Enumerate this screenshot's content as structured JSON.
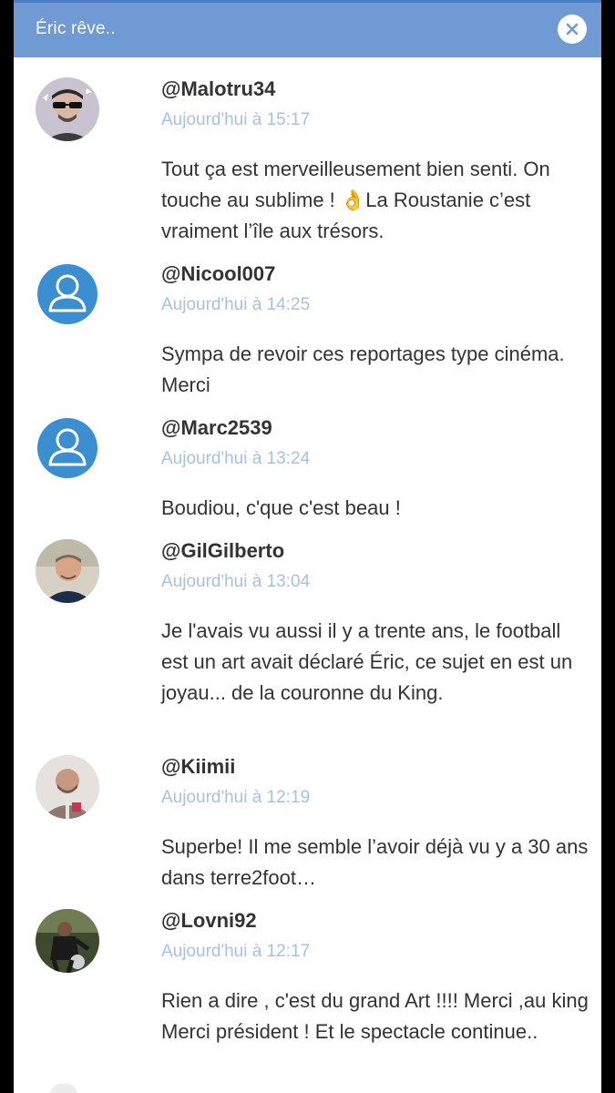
{
  "header": {
    "title": "Éric rêve..",
    "close_icon": "close-icon"
  },
  "comments": [
    {
      "username": "@Malotru34",
      "time": "Aujourd'hui à 15:17",
      "text": "Tout ça est merveilleusement bien senti. On touche au sublime ! 👌La Roustanie c’est vraiment l’île aux trésors.",
      "avatar": "photo"
    },
    {
      "username": "@Nicool007",
      "time": "Aujourd'hui à 14:25",
      "text": "Sympa de revoir ces reportages type cinéma. Merci",
      "avatar": "default-user-icon"
    },
    {
      "username": "@Marc2539",
      "time": "Aujourd'hui à 13:24",
      "text": "Boudiou, c'que c'est beau !",
      "avatar": "default-user-icon"
    },
    {
      "username": "@GilGilberto",
      "time": "Aujourd'hui à 13:04",
      "text": "Je l'avais vu aussi il y a trente ans, le football est un art avait déclaré Éric, ce sujet en est un joyau... de la couronne du King.",
      "avatar": "photo"
    },
    {
      "username": "@Kiimii",
      "time": "Aujourd'hui à 12:19",
      "text": "Superbe! Il me semble l’avoir déjà vu y a 30 ans dans terre2foot…",
      "avatar": "photo"
    },
    {
      "username": "@Lovni92",
      "time": "Aujourd'hui à 12:17",
      "text": "Rien a dire , c'est du grand Art !!!! Merci ,au king Merci président ! Et le spectacle continue..",
      "avatar": "photo"
    }
  ],
  "colors": {
    "header": "#6f9ad3",
    "time": "#a6c1e2",
    "default_avatar": "#3b8fd0"
  }
}
